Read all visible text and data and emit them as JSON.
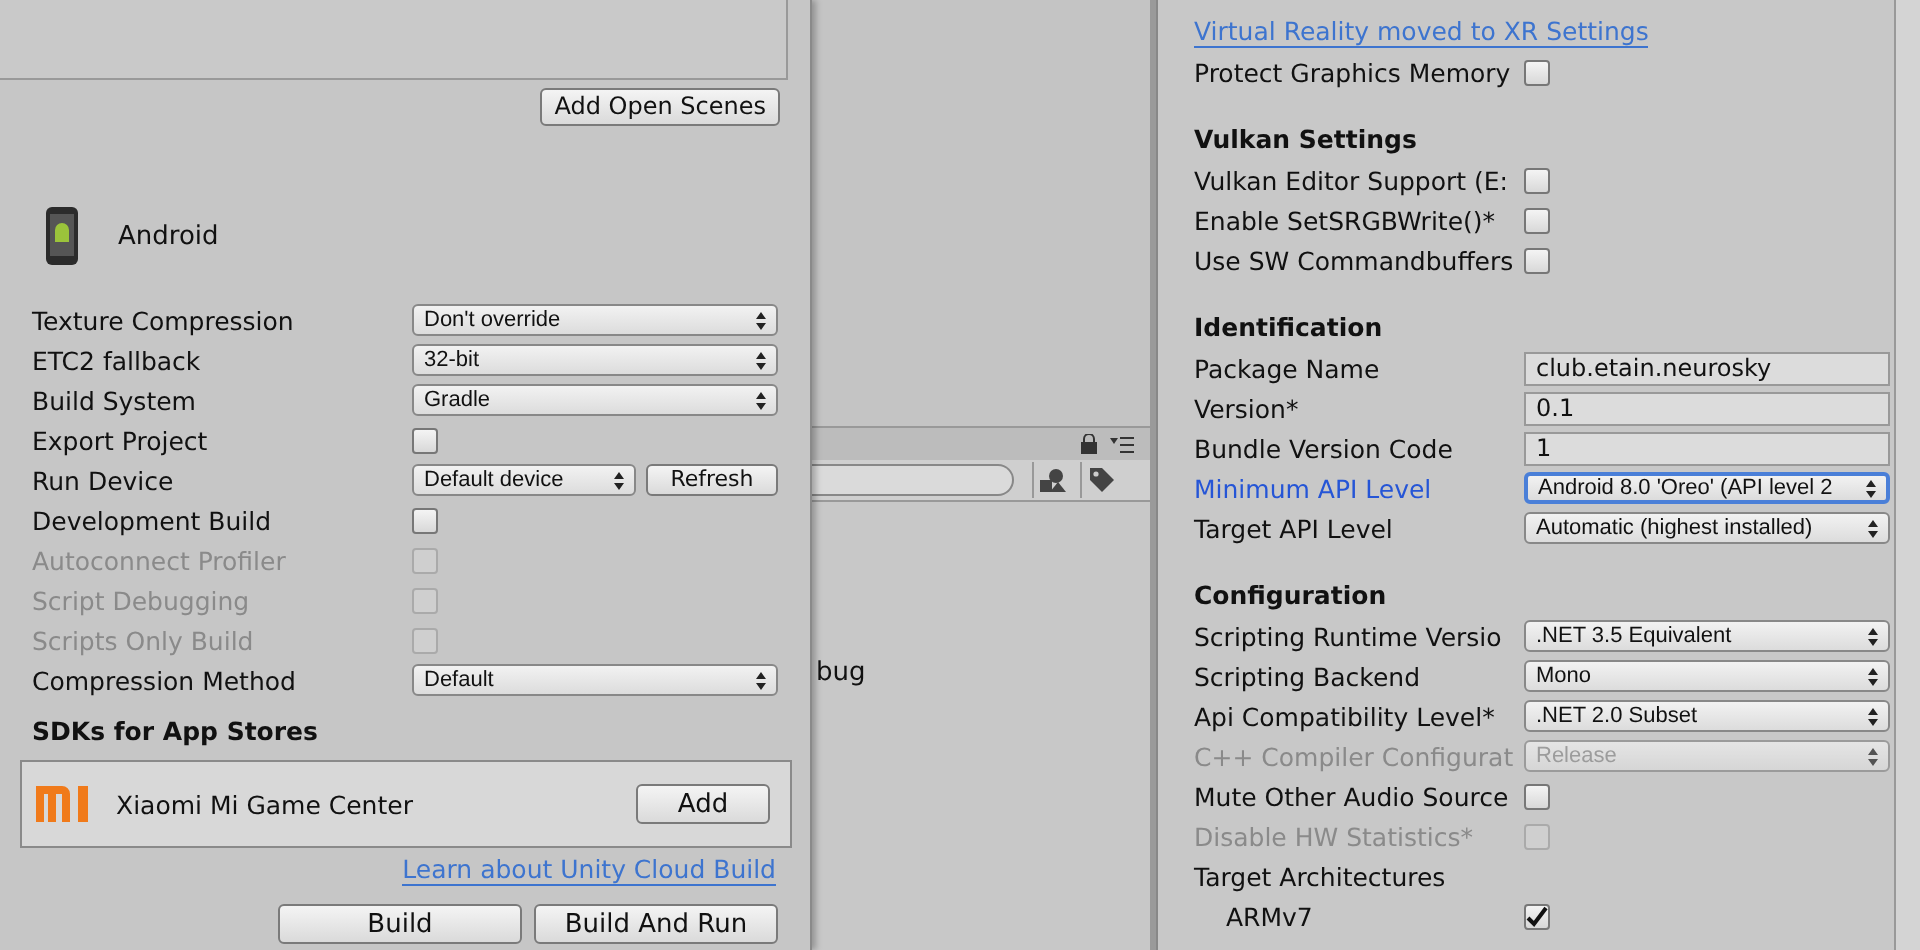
{
  "build_settings": {
    "add_scenes_button": "Add Open Scenes",
    "platform": "Android",
    "rows": [
      {
        "label": "Texture Compression",
        "kind": "dropdown",
        "value": "Don't override",
        "disabled": false
      },
      {
        "label": "ETC2 fallback",
        "kind": "dropdown",
        "value": "32-bit",
        "disabled": false
      },
      {
        "label": "Build System",
        "kind": "dropdown",
        "value": "Gradle",
        "disabled": false
      },
      {
        "label": "Export Project",
        "kind": "checkbox",
        "checked": false,
        "disabled": false
      },
      {
        "label": "Run Device",
        "kind": "dropdown_button",
        "value": "Default device",
        "button": "Refresh",
        "disabled": false
      },
      {
        "label": "Development Build",
        "kind": "checkbox",
        "checked": false,
        "disabled": false
      },
      {
        "label": "Autoconnect Profiler",
        "kind": "checkbox",
        "checked": false,
        "disabled": true
      },
      {
        "label": "Script Debugging",
        "kind": "checkbox",
        "checked": false,
        "disabled": true
      },
      {
        "label": "Scripts Only Build",
        "kind": "checkbox",
        "checked": false,
        "disabled": true
      },
      {
        "label": "Compression Method",
        "kind": "dropdown",
        "value": "Default",
        "disabled": false
      }
    ],
    "sdk_heading": "SDKs for App Stores",
    "sdk": {
      "name": "Xiaomi Mi Game Center",
      "button": "Add"
    },
    "link": "Learn about Unity Cloud Build",
    "buttons": [
      "Build",
      "Build And Run"
    ]
  },
  "background_panel": {
    "text": "bug"
  },
  "player_settings": {
    "sections": [
      {
        "link": "Virtual Reality moved to XR Settings",
        "rows": [
          {
            "label": "Protect Graphics Memory",
            "kind": "checkbox",
            "checked": false,
            "disabled": false,
            "focused": false
          }
        ]
      },
      {
        "heading": "Vulkan Settings",
        "rows": [
          {
            "label": "Vulkan Editor Support (E:",
            "kind": "checkbox",
            "checked": false,
            "disabled": false,
            "focused": false
          },
          {
            "label": "Enable SetSRGBWrite()*",
            "kind": "checkbox",
            "checked": false,
            "disabled": false,
            "focused": false
          },
          {
            "label": "Use SW Commandbuffers",
            "kind": "checkbox",
            "checked": false,
            "disabled": false,
            "focused": false
          }
        ]
      },
      {
        "heading": "Identification",
        "rows": [
          {
            "label": "Package Name",
            "kind": "text",
            "value": "club.etain.neurosky",
            "disabled": false,
            "focused": false
          },
          {
            "label": "Version*",
            "kind": "text",
            "value": "0.1",
            "disabled": false,
            "focused": false
          },
          {
            "label": "Bundle Version Code",
            "kind": "text",
            "value": "1",
            "disabled": false,
            "focused": false
          },
          {
            "label": "Minimum API Level",
            "kind": "dropdown",
            "value": "Android 8.0 'Oreo' (API level 2",
            "disabled": false,
            "focused": true
          },
          {
            "label": "Target API Level",
            "kind": "dropdown",
            "value": "Automatic (highest installed)",
            "disabled": false,
            "focused": false
          }
        ]
      },
      {
        "heading": "Configuration",
        "rows": [
          {
            "label": "Scripting Runtime Versio",
            "kind": "dropdown",
            "value": ".NET 3.5 Equivalent",
            "disabled": false,
            "focused": false
          },
          {
            "label": "Scripting Backend",
            "kind": "dropdown",
            "value": "Mono",
            "disabled": false,
            "focused": false
          },
          {
            "label": "Api Compatibility Level*",
            "kind": "dropdown",
            "value": ".NET 2.0 Subset",
            "disabled": false,
            "focused": false
          },
          {
            "label": "C++ Compiler Configurat",
            "kind": "dropdown",
            "value": "Release",
            "disabled": true,
            "focused": false
          },
          {
            "label": "Mute Other Audio Source",
            "kind": "checkbox",
            "checked": false,
            "disabled": false,
            "focused": false
          },
          {
            "label": "Disable HW Statistics*",
            "kind": "checkbox",
            "checked": false,
            "disabled": true,
            "focused": false
          },
          {
            "label": "Target Architectures",
            "kind": "group",
            "disabled": false,
            "focused": false,
            "children": [
              {
                "label": "ARMv7",
                "kind": "checkbox",
                "checked": true,
                "disabled": false,
                "focused": false
              }
            ]
          }
        ]
      }
    ]
  }
}
